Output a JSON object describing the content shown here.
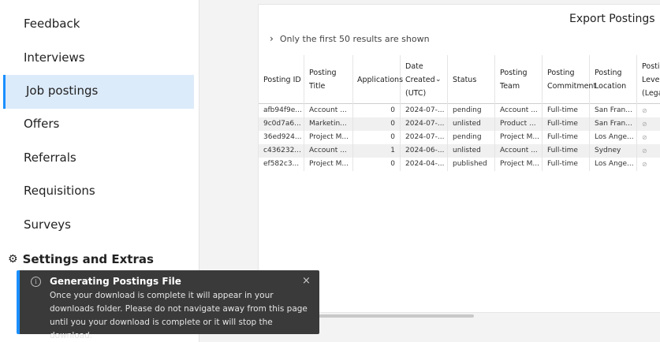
{
  "sidebar": {
    "items": [
      {
        "label": "Feedback"
      },
      {
        "label": "Interviews"
      },
      {
        "label": "Job postings"
      },
      {
        "label": "Offers"
      },
      {
        "label": "Referrals"
      },
      {
        "label": "Requisitions"
      },
      {
        "label": "Surveys"
      }
    ],
    "settings_label": "Settings and Extras",
    "settings_icon": "gear-icon"
  },
  "panel": {
    "export_label": "Export Postings",
    "notice_text": "Only the first 50 results are shown",
    "columns": [
      {
        "label": "Posting ID"
      },
      {
        "label": "Posting Title"
      },
      {
        "label": "Applications"
      },
      {
        "label": "Date Created (UTC)"
      },
      {
        "label": "Status"
      },
      {
        "label": "Posting Team"
      },
      {
        "label": "Posting Commitment"
      },
      {
        "label": "Posting Location"
      },
      {
        "label": "Posting Level (Legacy)"
      }
    ],
    "rows": [
      [
        "afb94f9e...",
        "Account ...",
        "0",
        "2024-07-...",
        "pending",
        "Account ...",
        "Full-time",
        "San Fran...",
        "⊘"
      ],
      [
        "9c0d7a6...",
        "Marketin...",
        "0",
        "2024-07-...",
        "unlisted",
        "Product ...",
        "Full-time",
        "San Fran...",
        "⊘"
      ],
      [
        "36ed924...",
        "Project M...",
        "0",
        "2024-07-...",
        "pending",
        "Project M...",
        "Full-time",
        "Los Ange...",
        "⊘"
      ],
      [
        "c436232...",
        "Account ...",
        "1",
        "2024-06-...",
        "unlisted",
        "Account ...",
        "Full-time",
        "Sydney",
        "⊘"
      ],
      [
        "ef582c3...",
        "Project M...",
        "0",
        "2024-04-...",
        "published",
        "Project M...",
        "Full-time",
        "Los Ange...",
        "⊘"
      ]
    ]
  },
  "toast": {
    "title": "Generating Postings File",
    "body": "Once your download is complete it will appear in your downloads folder. Please do not navigate away from this page until you your download is complete or it will stop the download.",
    "close": "×",
    "info": "i"
  },
  "colors": {
    "accent": "#1a8fff",
    "active_bg": "#dcebfa",
    "toast_bg": "#3a3a3a"
  }
}
